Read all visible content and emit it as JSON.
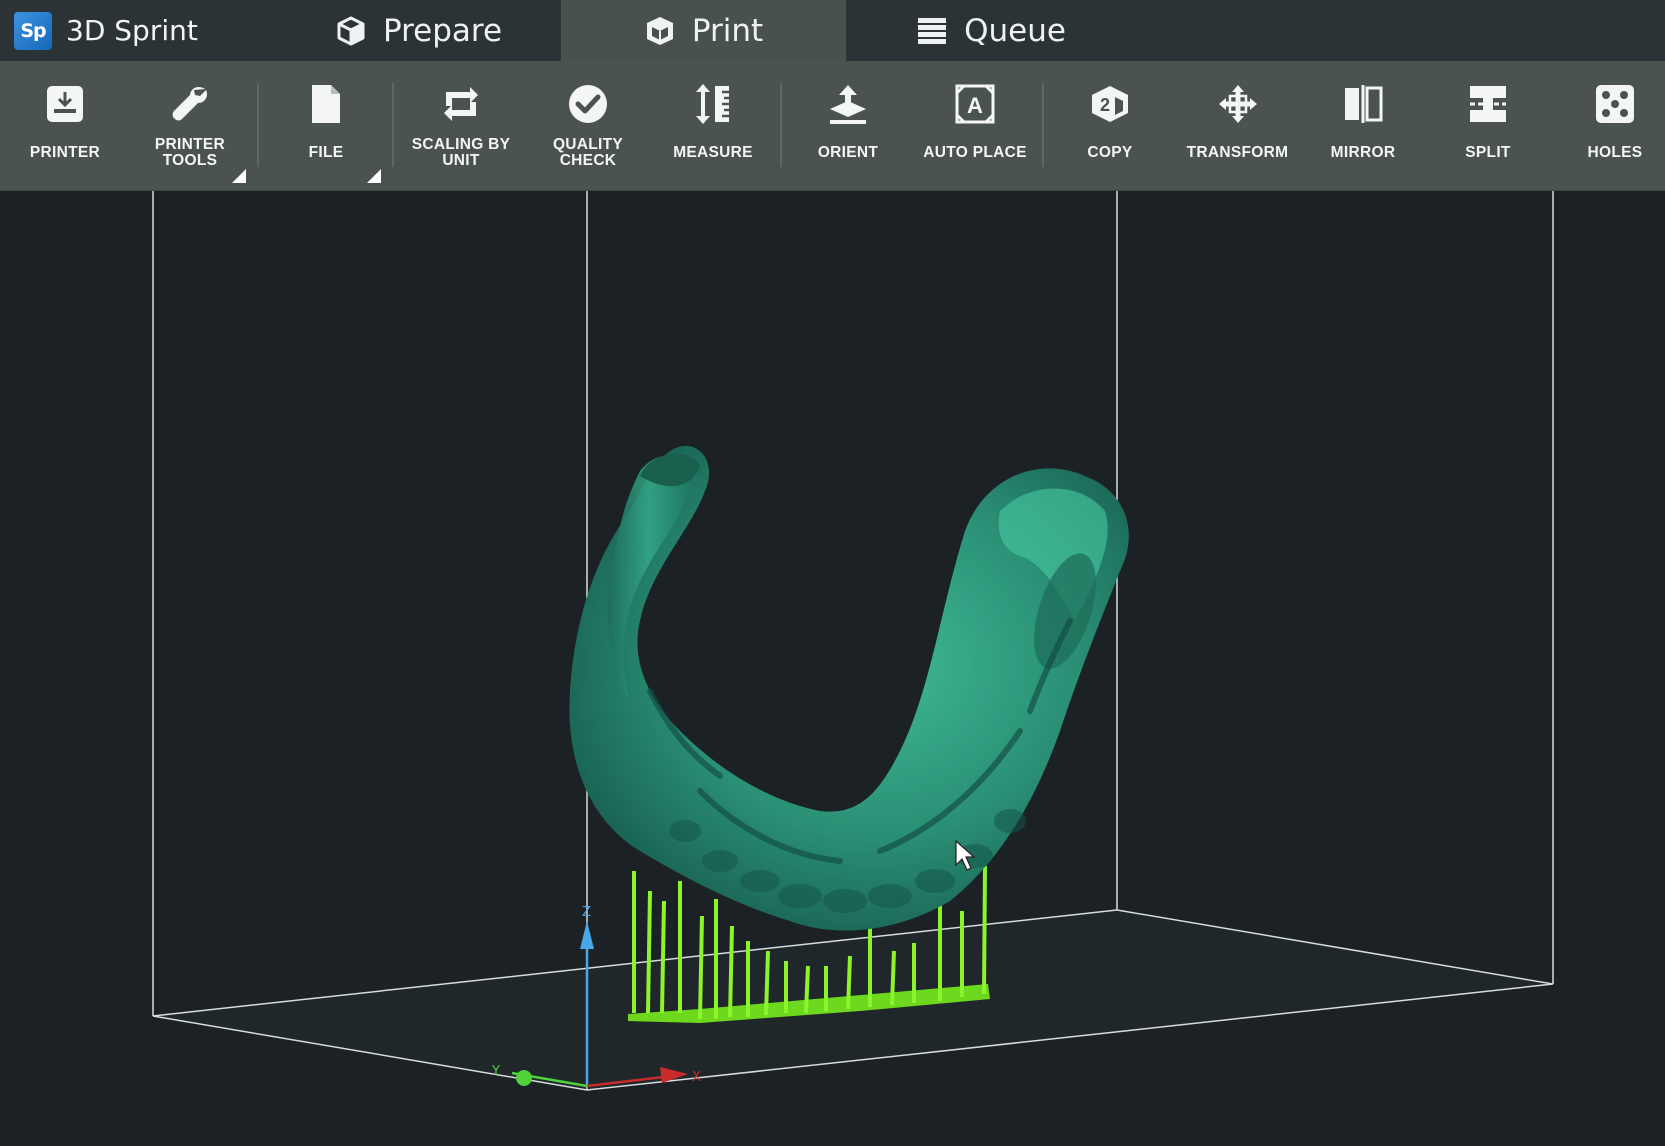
{
  "app": {
    "logo_text": "Sp",
    "name": "3D Sprint"
  },
  "tabs": [
    {
      "label": "Prepare",
      "icon": "cube-icon"
    },
    {
      "label": "Print",
      "icon": "cube-print-icon",
      "active": true
    },
    {
      "label": "Queue",
      "icon": "queue-list-icon"
    }
  ],
  "toolbar": {
    "printer": "PRINTER",
    "printer_tools": "PRINTER\nTOOLS",
    "file": "FILE",
    "scaling_by_unit": "SCALING BY\nUNIT",
    "quality_check": "QUALITY\nCHECK",
    "measure": "MEASURE",
    "orient": "ORIENT",
    "auto_place": "AUTO PLACE",
    "copy": "COPY",
    "transform": "TRANSFORM",
    "mirror": "MIRROR",
    "split": "SPLIT",
    "holes": "HOLES"
  },
  "icons": {
    "printer": "printer-icon",
    "printer_tools": "wrench-icon",
    "file": "file-icon",
    "scaling_by_unit": "scale-refresh-icon",
    "quality_check": "checkmark-circle-icon",
    "measure": "measure-icon",
    "orient": "orient-icon",
    "auto_place": "auto-place-icon",
    "copy": "copy-cube-icon",
    "transform": "transform-arrows-icon",
    "mirror": "mirror-icon",
    "split": "split-icon",
    "holes": "holes-dice-icon"
  },
  "viewport": {
    "axis_labels": {
      "x": "X",
      "y": "Y",
      "z": "Z"
    },
    "model_color": "#2f9a7e",
    "support_color": "#7ef022",
    "build_volume_line_color": "#d8dcdc"
  },
  "colors": {
    "topbar_bg": "#2c3336",
    "toolbar_bg": "#4b5351",
    "active_tab_bg": "#49514f",
    "viewport_bg": "#1b2124",
    "brand_logo": "#2a7fd0"
  }
}
